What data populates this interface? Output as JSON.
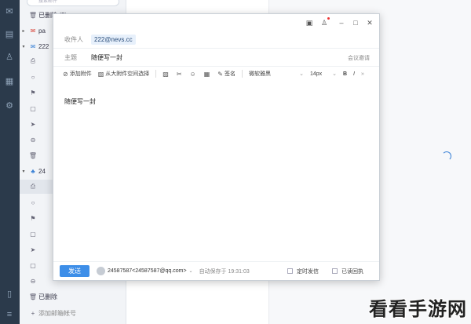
{
  "folder_pane": {
    "search_placeholder": "搜索邮件",
    "top_item_label": "已删除 (3)",
    "accounts": [
      {
        "label": "pa",
        "color": "#d9443b"
      },
      {
        "label": "222",
        "color": "#3b82d6"
      },
      {
        "label": "24",
        "color": "#3b82d6"
      }
    ],
    "deleted_label": "已删除",
    "add_account_label": "添加邮箱帐号"
  },
  "compose": {
    "to_label": "收件人",
    "to_value": "222@nevs.cc",
    "subject_label": "主题",
    "subject_value": "随便写一封",
    "cc_link": "会议邀请",
    "toolbar": {
      "attach": "添加附件",
      "big_attach": "从大附件空间选择",
      "signature": "签名",
      "font": "微软雅黑",
      "size": "14px",
      "bold": "B",
      "italic": "I",
      "more": "»"
    },
    "body_text": "随便写一封",
    "footer": {
      "send": "发送",
      "sender": "24587587<24587587@qq.com>",
      "autosave": "自动保存于 19:31:03",
      "scheduled": "定时发信",
      "read_receipt": "已读回执"
    }
  },
  "watermark": "看看手游网",
  "colors": {
    "accent": "#3d8ee8",
    "rail": "#2b3a4b"
  }
}
